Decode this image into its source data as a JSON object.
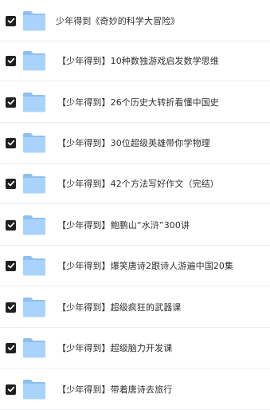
{
  "files": [
    {
      "name": "少年得到《奇妙的科学大冒险》",
      "checked": true
    },
    {
      "name": "【少年得到】10种数独游戏启发数学思维",
      "checked": true
    },
    {
      "name": "【少年得到】26个历史大转折看懂中国史",
      "checked": true
    },
    {
      "name": "【少年得到】30位超级英雄带你学物理",
      "checked": true
    },
    {
      "name": "【少年得到】42个方法写好作文（完结）",
      "checked": true
    },
    {
      "name": "【少年得到】鲍鹏山“水浒”300讲",
      "checked": true
    },
    {
      "name": "【少年得到】爆笑唐诗2跟诗人游遍中国20集",
      "checked": true
    },
    {
      "name": "【少年得到】超级疯狂的武器课",
      "checked": true
    },
    {
      "name": "【少年得到】超级脑力开发课",
      "checked": true
    },
    {
      "name": "【少年得到】带着唐诗去旅行",
      "checked": true
    }
  ],
  "colors": {
    "checkbox": "#202020",
    "folder_back": "#8fbfee",
    "folder_front": "#a9d3fb",
    "text": "#303030"
  },
  "icons": {
    "checkbox": "checkbox-checked-icon",
    "folder": "folder-icon"
  }
}
